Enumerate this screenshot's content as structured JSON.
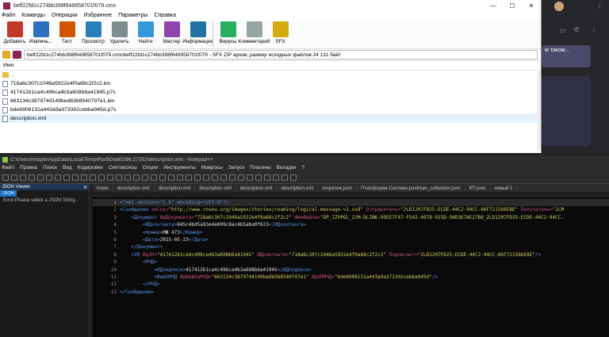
{
  "winrar": {
    "title": "beff22fd1c274bb398f649958701f079.cmx",
    "window_controls": [
      "—",
      "☐",
      "✕"
    ],
    "menu": [
      "Файл",
      "Команды",
      "Операции",
      "Избранное",
      "Параметры",
      "Справка"
    ],
    "toolbar": [
      {
        "label": "Добавить",
        "color": "#c0392b"
      },
      {
        "label": "Извлечь...",
        "color": "#2e6fbf"
      },
      {
        "label": "Тест",
        "color": "#d35400"
      },
      {
        "label": "Просмотр",
        "color": "#2980b9"
      },
      {
        "label": "Удалить",
        "color": "#7f8c8d"
      },
      {
        "label": "Найти",
        "color": "#3498db"
      },
      {
        "label": "Мастер",
        "color": "#8e44ad"
      },
      {
        "label": "Информация",
        "color": "#2471a3"
      },
      {
        "label": "Вирусы",
        "color": "#27ae60"
      },
      {
        "label": "Комментарий",
        "color": "#95a5a6"
      },
      {
        "label": "SFX",
        "color": "#d4ac0d"
      }
    ],
    "path": "beff22fd1c274bb398f649958701f079.cmx\\beff22fd1c274bb398f649958701f079 - SFX ZIP архив, размер исходных файлов 24 131 байт",
    "column_header": "Имя",
    "files": [
      {
        "name": "..",
        "type": "folder"
      },
      {
        "name": "718a6c307c1046a5922e4f0a68c2f2c2.bin",
        "type": "file"
      },
      {
        "name": "417412b1ca4c496ca4b3a608b6a41945.p7s",
        "type": "file"
      },
      {
        "name": "663134c3879744149bed6368540797e1.bin",
        "type": "file"
      },
      {
        "name": "bde6908131a443a9a373392cebba945d.p7s",
        "type": "file"
      },
      {
        "name": "description.xml",
        "type": "file",
        "selected": true
      }
    ]
  },
  "background_app": {
    "snippet": "м таком..."
  },
  "npp": {
    "title": "C:\\Users\\mlapte\\AppData\\Local\\Temp\\Rar$DIa65396.27352\\description.xml - Notepad++",
    "menu": [
      "Файл",
      "Правка",
      "Поиск",
      "Вид",
      "Кодировки",
      "Синтаксисы",
      "Опции",
      "Инструменты",
      "Макросы",
      "Запуск",
      "Плагины",
      "Вкладки",
      "?"
    ],
    "tabs": [
      "hoste",
      "description.xml",
      "description.xml",
      "description.xml",
      "description.xml",
      "description.xml",
      "response.json",
      "Платформа Сислинк.postman_collection.json",
      "КП.json",
      "новый 1"
    ],
    "json_viewer": {
      "title": "JSON Viewer",
      "close": "✕",
      "tab": "JSON",
      "error": "Error:Please select a JSON String."
    },
    "lines": [
      {
        "n": "1",
        "html": "<span class=\"pi\">&lt;?xml version=\"1.0\" encoding=\"utf-8\"?&gt;</span>"
      },
      {
        "n": "2",
        "html": "<span class=\"tagc\">&lt;Сообщение</span> <span class=\"attr\">xmlns=</span><span class=\"val\">\"http://www.roseu.org/images/stories/roaming/logical-message-v1.xsd\"</span> <span class=\"attr\">Отправитель=</span><span class=\"val\">\"2LD1207FD25-ECDE-44C2-94CC-86F721566E8E\"</span> <span class=\"attr\">Получатель=</span><span class=\"val\">\"2LM</span>"
      },
      {
        "n": "3",
        "html": "    <span class=\"tagc\">&lt;Документ</span> <span class=\"attr\">ИдДокумента=</span><span class=\"val\">\"718a6c307c1046a5922e4f0a68c2f2c2\"</span> <span class=\"attr\">ИмяФайла=</span><span class=\"val\">\"DP_IZVPOL_2JM-DLINK-99EE7F47-F542-4078-915D-94D367AE27B8_2LD1207FD25-ECDE-44C2-94CC-</span>"
      },
      {
        "n": "4",
        "html": "        <span class=\"tagc\">&lt;ИДконтента&gt;</span><span class=\"text\">845c4bd5a93e4e009c8ac4b5aba0f623</span><span class=\"tagc\">&lt;/ИДконтента&gt;</span>"
      },
      {
        "n": "5",
        "html": "        <span class=\"tagc\">&lt;Номер&gt;</span><span class=\"text\">МЖ 473</span><span class=\"tagc\">&lt;/Номер&gt;</span>"
      },
      {
        "n": "6",
        "html": "        <span class=\"tagc\">&lt;Дата&gt;</span><span class=\"text\">2025-05-23</span><span class=\"tagc\">&lt;/Дата&gt;</span>"
      },
      {
        "n": "7",
        "html": "    <span class=\"tagc\">&lt;/Документ&gt;</span>"
      },
      {
        "n": "8",
        "html": "    <span class=\"tagc\">&lt;ЭП</span> <span class=\"attr\">ИдЭП=</span><span class=\"val\">\"417412b1ca4c496ca4b3a608b6a41945\"</span> <span class=\"attr\">ИДконтента=</span><span class=\"val\">\"718a6c307c1046a5922e4f0a68c2f2c2\"</span> <span class=\"attr\">Подписант=</span><span class=\"val\">\"2LD1207FD25-ECDE-44C2-94CC-86F721566E8E\"</span><span class=\"tagc\">/&gt;</span>"
      },
      {
        "n": "9",
        "html": "        <span class=\"tagc\">&lt;МЧД&gt;</span>"
      },
      {
        "n": "10",
        "html": "            <span class=\"tagc\">&lt;ИДподписи&gt;</span><span class=\"text\">417412b1ca4c496ca4b3a608b6a41945</span><span class=\"tagc\">&lt;/ИДподписи&gt;</span>"
      },
      {
        "n": "11",
        "html": "            <span class=\"tagc\">&lt;ФайлМЧД</span> <span class=\"attr\">ИдФайлаМЧД=</span><span class=\"val\">\"663134c3879744149bed6368540797e1\"</span> <span class=\"attr\">ИдЭПМЧД=</span><span class=\"val\">\"bde6908131a443a9a373392cebba945d\"</span><span class=\"tagc\">/&gt;</span>"
      },
      {
        "n": "12",
        "html": "        <span class=\"tagc\">&lt;/МЧД&gt;</span>"
      },
      {
        "n": "13",
        "html": "<span class=\"tagc\">&lt;/Сообщение&gt;</span>"
      }
    ]
  }
}
